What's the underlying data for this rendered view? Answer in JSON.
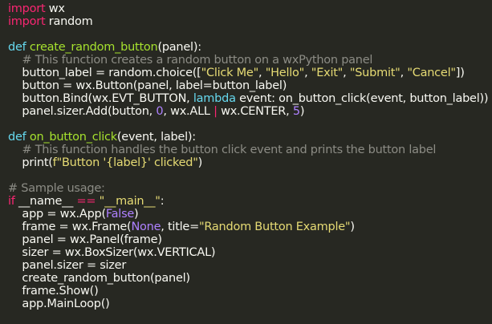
{
  "theme": {
    "background": "#272822",
    "foreground": "#f8f8f2",
    "keyword": "#f92672",
    "def": "#66d9ef",
    "function": "#a6e22e",
    "string": "#e6db74",
    "number": "#ae81ff",
    "comment": "#8c8c85"
  },
  "code": [
    [
      [
        "kw",
        "import"
      ],
      [
        "p",
        " wx"
      ]
    ],
    [
      [
        "kw",
        "import"
      ],
      [
        "p",
        " random"
      ]
    ],
    [],
    [
      [
        "df",
        "def"
      ],
      [
        "p",
        " "
      ],
      [
        "fn",
        "create_random_button"
      ],
      [
        "p",
        "(panel):"
      ]
    ],
    [
      [
        "p",
        "    "
      ],
      [
        "cm",
        "# This function creates a random button on a wxPython panel"
      ]
    ],
    [
      [
        "p",
        "    button_label = random.choice(["
      ],
      [
        "st",
        "\"Click Me\""
      ],
      [
        "p",
        ", "
      ],
      [
        "st",
        "\"Hello\""
      ],
      [
        "p",
        ", "
      ],
      [
        "st",
        "\"Exit\""
      ],
      [
        "p",
        ", "
      ],
      [
        "st",
        "\"Submit\""
      ],
      [
        "p",
        ", "
      ],
      [
        "st",
        "\"Cancel\""
      ],
      [
        "p",
        "])"
      ]
    ],
    [
      [
        "p",
        "    button = wx.Button(panel, label=button_label)"
      ]
    ],
    [
      [
        "p",
        "    button.Bind(wx.EVT_BUTTON, "
      ],
      [
        "df",
        "lambda"
      ],
      [
        "p",
        " event: on_button_click(event, button_label))"
      ]
    ],
    [
      [
        "p",
        "    panel.sizer.Add(button, "
      ],
      [
        "nm",
        "0"
      ],
      [
        "p",
        ", wx.ALL "
      ],
      [
        "kw",
        "|"
      ],
      [
        "p",
        " wx.CENTER, "
      ],
      [
        "nm",
        "5"
      ],
      [
        "p",
        ")"
      ]
    ],
    [],
    [
      [
        "df",
        "def"
      ],
      [
        "p",
        " "
      ],
      [
        "fn",
        "on_button_click"
      ],
      [
        "p",
        "(event, label):"
      ]
    ],
    [
      [
        "p",
        "    "
      ],
      [
        "cm",
        "# This function handles the button click event and prints the button label"
      ]
    ],
    [
      [
        "p",
        "    print("
      ],
      [
        "st",
        "f\"Button '{label}' clicked\""
      ],
      [
        "p",
        ")"
      ]
    ],
    [],
    [
      [
        "cm",
        "# Sample usage:"
      ]
    ],
    [
      [
        "kw",
        "if"
      ],
      [
        "p",
        " __name__ "
      ],
      [
        "kw",
        "=="
      ],
      [
        "p",
        " "
      ],
      [
        "st",
        "\"__main__\""
      ],
      [
        "p",
        ":"
      ]
    ],
    [
      [
        "p",
        "    app = wx.App("
      ],
      [
        "nm",
        "False"
      ],
      [
        "p",
        ")"
      ]
    ],
    [
      [
        "p",
        "    frame = wx.Frame("
      ],
      [
        "nm",
        "None"
      ],
      [
        "p",
        ", title="
      ],
      [
        "st",
        "\"Random Button Example\""
      ],
      [
        "p",
        ")"
      ]
    ],
    [
      [
        "p",
        "    panel = wx.Panel(frame)"
      ]
    ],
    [
      [
        "p",
        "    sizer = wx.BoxSizer(wx.VERTICAL)"
      ]
    ],
    [
      [
        "p",
        "    panel.sizer = sizer"
      ]
    ],
    [
      [
        "p",
        "    create_random_button(panel)"
      ]
    ],
    [
      [
        "p",
        "    frame.Show()"
      ]
    ],
    [
      [
        "p",
        "    app.MainLoop()"
      ]
    ]
  ]
}
